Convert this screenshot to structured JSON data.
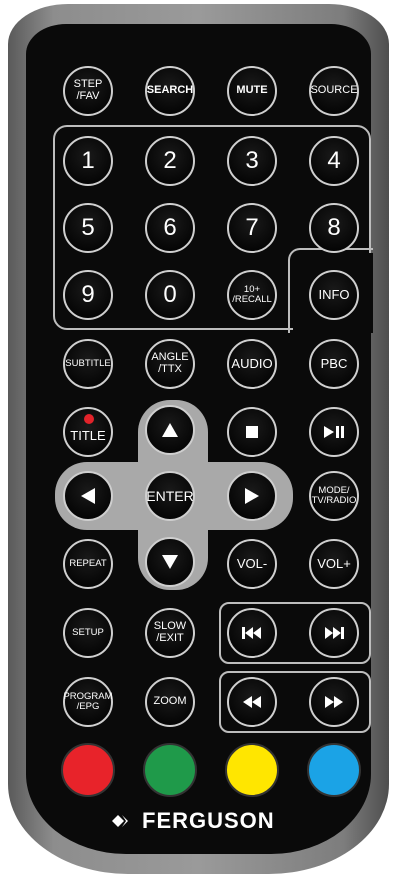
{
  "brand": {
    "name": "FERGUSON"
  },
  "rows": {
    "r1": [
      "STEP\n/FAV",
      "SEARCH",
      "MUTE",
      "SOURCE"
    ],
    "numbers": [
      "1",
      "2",
      "3",
      "4",
      "5",
      "6",
      "7",
      "8",
      "9",
      "0"
    ],
    "recall": "10+\n/RECALL",
    "info": "INFO",
    "r5": [
      "SUBTITLE",
      "ANGLE\n/TTX",
      "AUDIO",
      "PBC"
    ],
    "title": "TITLE",
    "enter": "ENTER",
    "mode": "MODE/\nTV/RADIO",
    "repeat": "REPEAT",
    "vol_minus": "VOL-",
    "vol_plus": "VOL+",
    "setup": "SETUP",
    "slow_exit": "SLOW\n/EXIT",
    "program_epg": "PROGRAM\n/EPG",
    "zoom": "ZOOM"
  },
  "colors": {
    "red": "#e8232a",
    "green": "#1f9a4a",
    "yellow": "#ffe600",
    "blue": "#1ba3e6"
  },
  "icons": {
    "up": "triangle-up-icon",
    "down": "triangle-down-icon",
    "left": "triangle-left-icon",
    "right": "triangle-right-icon",
    "stop": "stop-icon",
    "play_pause": "play-pause-icon",
    "prev": "skip-previous-icon",
    "next": "skip-next-icon",
    "rewind": "rewind-icon",
    "forward": "fast-forward-icon"
  }
}
